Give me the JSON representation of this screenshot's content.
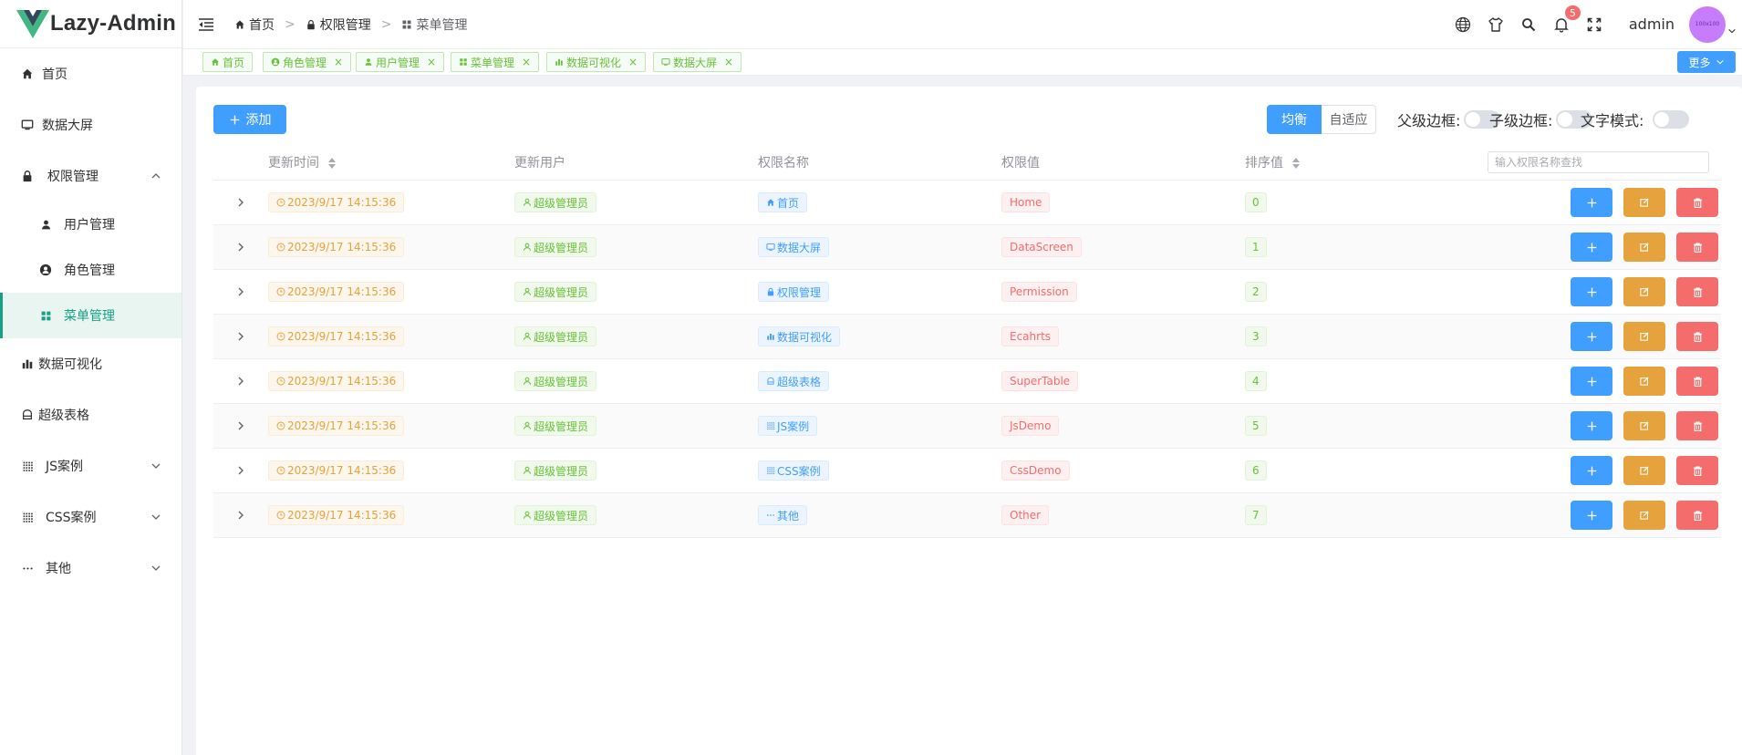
{
  "app": {
    "logo_text": "Lazy-Admin",
    "brand_color": "#16a085"
  },
  "sidebar": {
    "items": [
      {
        "label": "首页",
        "icon": "home-icon"
      },
      {
        "label": "数据大屏",
        "icon": "monitor-icon"
      },
      {
        "label": "权限管理",
        "icon": "lock-icon",
        "expanded": true
      },
      {
        "label": "用户管理",
        "icon": "user-icon",
        "sub": true
      },
      {
        "label": "角色管理",
        "icon": "user-circle-icon",
        "sub": true
      },
      {
        "label": "菜单管理",
        "icon": "grid-icon",
        "sub": true,
        "active": true
      },
      {
        "label": "数据可视化",
        "icon": "bar-chart-icon"
      },
      {
        "label": "超级表格",
        "icon": "table-icon"
      },
      {
        "label": "JS案例",
        "icon": "dots-grid-icon",
        "collapsed": true
      },
      {
        "label": "CSS案例",
        "icon": "dots-grid-icon",
        "collapsed": true
      },
      {
        "label": "其他",
        "icon": "ellipsis-icon",
        "collapsed": true
      }
    ]
  },
  "header": {
    "breadcrumb": [
      "首页",
      "权限管理",
      "菜单管理"
    ],
    "breadcrumb_sep": ">",
    "notification_count": "5",
    "username": "admin",
    "avatar_text": "100x100"
  },
  "tabs": {
    "items": [
      {
        "label": "首页",
        "closable": false
      },
      {
        "label": "角色管理",
        "closable": true
      },
      {
        "label": "用户管理",
        "closable": true
      },
      {
        "label": "菜单管理",
        "closable": true
      },
      {
        "label": "数据可视化",
        "closable": true
      },
      {
        "label": "数据大屏",
        "closable": true
      }
    ],
    "close_glyph": "×",
    "more_label": "更多"
  },
  "toolbar": {
    "add_label": "添加",
    "seg_balanced": "均衡",
    "seg_adaptive": "自适应",
    "parent_border_label": "父级边框:",
    "child_border_label": "子级边框:",
    "text_mode_label": "文字模式:"
  },
  "table": {
    "headers": {
      "time": "更新时间",
      "user": "更新用户",
      "name": "权限名称",
      "value": "权限值",
      "sort": "排序值"
    },
    "search_placeholder": "输入权限名称查找",
    "rows": [
      {
        "time": "2023/9/17 14:15:36",
        "user": "超级管理员",
        "name": "首页",
        "name_icon": "home-icon",
        "value": "Home",
        "sort": "0"
      },
      {
        "time": "2023/9/17 14:15:36",
        "user": "超级管理员",
        "name": "数据大屏",
        "name_icon": "monitor-icon",
        "value": "DataScreen",
        "sort": "1"
      },
      {
        "time": "2023/9/17 14:15:36",
        "user": "超级管理员",
        "name": "权限管理",
        "name_icon": "lock-icon",
        "value": "Permission",
        "sort": "2"
      },
      {
        "time": "2023/9/17 14:15:36",
        "user": "超级管理员",
        "name": "数据可视化",
        "name_icon": "bar-chart-icon",
        "value": "Ecahrts",
        "sort": "3"
      },
      {
        "time": "2023/9/17 14:15:36",
        "user": "超级管理员",
        "name": "超级表格",
        "name_icon": "table-icon",
        "value": "SuperTable",
        "sort": "4"
      },
      {
        "time": "2023/9/17 14:15:36",
        "user": "超级管理员",
        "name": "JS案例",
        "name_icon": "dots-grid-icon",
        "value": "JsDemo",
        "sort": "5"
      },
      {
        "time": "2023/9/17 14:15:36",
        "user": "超级管理员",
        "name": "CSS案例",
        "name_icon": "dots-grid-icon",
        "value": "CssDemo",
        "sort": "6"
      },
      {
        "time": "2023/9/17 14:15:36",
        "user": "超级管理员",
        "name": "其他",
        "name_icon": "ellipsis-icon",
        "value": "Other",
        "sort": "7"
      }
    ]
  }
}
